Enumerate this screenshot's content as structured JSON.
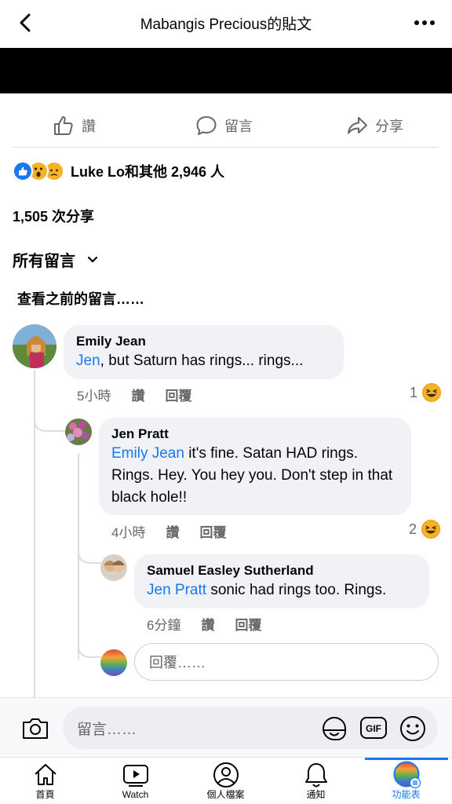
{
  "header": {
    "title": "Mabangis Precious的貼文",
    "back_icon": "chevron-left-icon",
    "more_icon": "more-horizontal-icon"
  },
  "actions": [
    {
      "label": "讚",
      "icon": "thumbs-up-icon"
    },
    {
      "label": "留言",
      "icon": "comment-icon"
    },
    {
      "label": "分享",
      "icon": "share-icon"
    }
  ],
  "reactions": {
    "icons": [
      "like-reaction-icon",
      "wow-reaction-icon",
      "sad-reaction-icon"
    ],
    "summary": "Luke Lo和其他 2,946 人"
  },
  "shares": "1,505 次分享",
  "comments_filter": "所有留言",
  "view_previous": "查看之前的留言……",
  "comments": [
    {
      "name": "Emily Jean",
      "mention": "Jen",
      "text": ", but Saturn has rings... rings...",
      "time": "5小時",
      "like": "讚",
      "reply": "回覆",
      "reaction_count": "1"
    },
    {
      "name": "Jen Pratt",
      "mention": "Emily Jean",
      "text": " it's fine.  Satan HAD rings. Rings.  Hey. You hey you. Don't step in that black hole!!",
      "time": "4小時",
      "like": "讚",
      "reply": "回覆",
      "reaction_count": "2"
    },
    {
      "name": "Samuel Easley Sutherland",
      "mention": "Jen Pratt",
      "text": " sonic had rings too. Rings.",
      "time": "6分鐘",
      "like": "讚",
      "reply": "回覆"
    }
  ],
  "reply_placeholder": "回覆……",
  "composer": {
    "placeholder": "留言……",
    "camera_icon": "camera-icon",
    "sticker_icon": "sticker-icon",
    "gif_label": "GIF",
    "emoji_icon": "emoji-icon"
  },
  "tabs": [
    {
      "label": "首頁",
      "icon": "home-icon"
    },
    {
      "label": "Watch",
      "icon": "watch-icon"
    },
    {
      "label": "個人檔案",
      "icon": "profile-icon"
    },
    {
      "label": "通知",
      "icon": "bell-icon"
    },
    {
      "label": "功能表",
      "icon": "menu-icon",
      "active": true
    }
  ],
  "colors": {
    "link": "#1877f2",
    "bubble": "#f0f2f5",
    "secondary_text": "#65676b"
  }
}
